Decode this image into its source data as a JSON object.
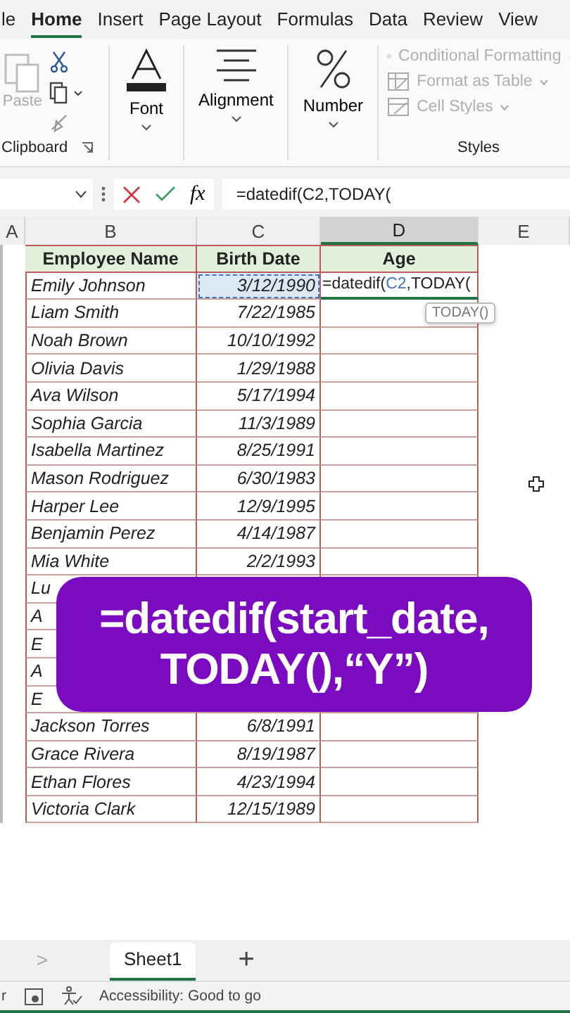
{
  "ribbon_tabs": [
    {
      "label": "le",
      "selected": false
    },
    {
      "label": "Home",
      "selected": true
    },
    {
      "label": "Insert",
      "selected": false
    },
    {
      "label": "Page Layout",
      "selected": false
    },
    {
      "label": "Formulas",
      "selected": false
    },
    {
      "label": "Data",
      "selected": false
    },
    {
      "label": "Review",
      "selected": false
    },
    {
      "label": "View",
      "selected": false
    }
  ],
  "clipboard": {
    "paste_label": "Paste",
    "paste_disabled": true,
    "group_label": "Clipboard"
  },
  "groups": [
    {
      "label": "Font",
      "kind": "font"
    },
    {
      "label": "Alignment",
      "kind": "alignment"
    },
    {
      "label": "Number",
      "kind": "number"
    }
  ],
  "styles": {
    "items": [
      {
        "label": "Conditional Formatting",
        "kind": "conditional",
        "disabled": true
      },
      {
        "label": "Format as Table",
        "kind": "table",
        "disabled": true
      },
      {
        "label": "Cell Styles",
        "kind": "cellstyles",
        "disabled": true
      }
    ],
    "group_label": "Styles"
  },
  "formula_bar": {
    "fx": "fx",
    "value": "=datedif(C2,TODAY("
  },
  "columns": [
    {
      "label": "A",
      "selected": false
    },
    {
      "label": "B",
      "selected": false
    },
    {
      "label": "C",
      "selected": false
    },
    {
      "label": "D",
      "selected": true
    },
    {
      "label": "E",
      "selected": false
    }
  ],
  "table_header": [
    "Employee Name",
    "Birth Date",
    "Age"
  ],
  "rows": [
    {
      "name": "Emily Johnson",
      "birth_date": "3/12/1990",
      "date_referenced": true,
      "age_edit": {
        "parts": [
          {
            "text": "=datedif(",
            "kind": "plain"
          },
          {
            "text": "C2",
            "kind": "ref"
          },
          {
            "text": ",TODAY(",
            "kind": "plain"
          }
        ],
        "tooltip": "TODAY()"
      }
    },
    {
      "name": "Liam Smith",
      "birth_date": "7/22/1985",
      "date_referenced": false
    },
    {
      "name": "Noah Brown",
      "birth_date": "10/10/1992",
      "date_referenced": false
    },
    {
      "name": "Olivia Davis",
      "birth_date": "1/29/1988",
      "date_referenced": false
    },
    {
      "name": "Ava Wilson",
      "birth_date": "5/17/1994",
      "date_referenced": false
    },
    {
      "name": "Sophia Garcia",
      "birth_date": "11/3/1989",
      "date_referenced": false
    },
    {
      "name": "Isabella Martinez",
      "birth_date": "8/25/1991",
      "date_referenced": false
    },
    {
      "name": "Mason Rodriguez",
      "birth_date": "6/30/1983",
      "date_referenced": false
    },
    {
      "name": "Harper Lee",
      "birth_date": "12/9/1995",
      "date_referenced": false
    },
    {
      "name": "Benjamin Perez",
      "birth_date": "4/14/1987",
      "date_referenced": false
    },
    {
      "name": "Mia White",
      "birth_date": "2/2/1993",
      "date_referenced": false
    },
    {
      "name": "Lu"
    },
    {
      "name": "A"
    },
    {
      "name": "E"
    },
    {
      "name": "A"
    },
    {
      "name": "E"
    },
    {
      "name": "Jackson Torres",
      "birth_date": "6/8/1991",
      "date_referenced": false
    },
    {
      "name": "Grace Rivera",
      "birth_date": "8/19/1987",
      "date_referenced": false
    },
    {
      "name": "Ethan Flores",
      "birth_date": "4/23/1994",
      "date_referenced": false
    },
    {
      "name": "Victoria Clark",
      "birth_date": "12/15/1989",
      "date_referenced": false
    }
  ],
  "caption": [
    "=datedif(start_date,",
    "TODAY(),“Y”)"
  ],
  "sheet_tabs": {
    "prev": ">",
    "tabs": [
      {
        "label": "Sheet1",
        "selected": true
      }
    ],
    "add": "+"
  },
  "status_bar": {
    "left": "r",
    "accessibility": "Accessibility: Good to go"
  }
}
